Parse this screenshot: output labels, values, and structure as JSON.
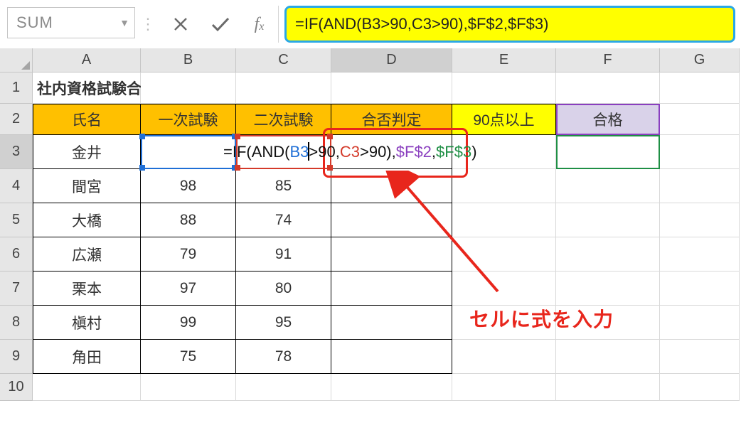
{
  "name_box": "SUM",
  "formula_bar": "=IF(AND(B3>90,C3>90),$F$2,$F$3)",
  "columns": [
    "A",
    "B",
    "C",
    "D",
    "E",
    "F",
    "G"
  ],
  "rows": [
    "1",
    "2",
    "3",
    "4",
    "5",
    "6",
    "7",
    "8",
    "9",
    "10"
  ],
  "title_cell": "社内資格試験合格者",
  "headers": {
    "A": "氏名",
    "B": "一次試験",
    "C": "二次試験",
    "D": "合否判定",
    "E": "90点以上",
    "F": "合格"
  },
  "data_rows": [
    {
      "name": "金井",
      "s1": "",
      "s2": ""
    },
    {
      "name": "間宮",
      "s1": "98",
      "s2": "85"
    },
    {
      "name": "大橋",
      "s1": "88",
      "s2": "74"
    },
    {
      "name": "広瀬",
      "s1": "79",
      "s2": "91"
    },
    {
      "name": "栗本",
      "s1": "97",
      "s2": "80"
    },
    {
      "name": "槇村",
      "s1": "99",
      "s2": "95"
    },
    {
      "name": "角田",
      "s1": "75",
      "s2": "78"
    }
  ],
  "inline_formula": {
    "prefix": "=IF(AND(",
    "ref1": "B3",
    "op1": ">90,",
    "ref2": "C3",
    "op2": ">90)",
    "comma": ",",
    "ref3": "$F$2",
    "comma2": ",",
    "ref4": "$F$3",
    "close": ")"
  },
  "annotation": "セルに式を入力",
  "active_col": "D",
  "active_row": "3"
}
